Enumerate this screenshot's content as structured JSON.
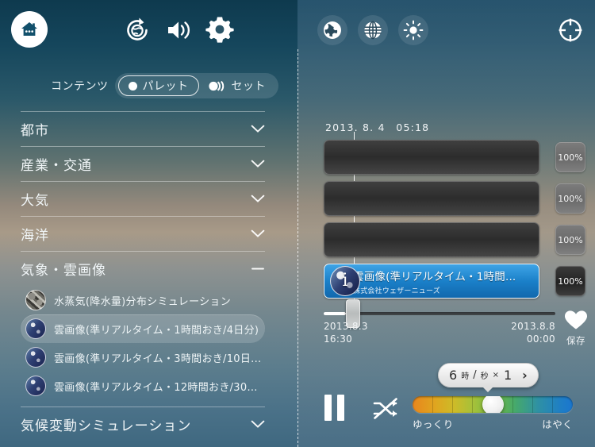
{
  "topbar": {
    "home_button": "home-icon",
    "buttons": [
      {
        "name": "globe-rotate-icon",
        "label": ""
      },
      {
        "name": "volume-icon",
        "label": ""
      },
      {
        "name": "gear-icon",
        "label": ""
      },
      {
        "name": "earth-icon",
        "label": ""
      },
      {
        "name": "grid-globe-icon",
        "label": ""
      },
      {
        "name": "brightness-icon",
        "label": ""
      },
      {
        "name": "crosshair-icon",
        "label": ""
      }
    ]
  },
  "content_toggle": {
    "label": "コンテンツ",
    "options": [
      {
        "label": "パレット",
        "selected": true
      },
      {
        "label": "セット",
        "selected": false
      }
    ]
  },
  "sidebar": {
    "categories": [
      {
        "label": "都市",
        "expanded": false,
        "toggle": "⌄"
      },
      {
        "label": "産業・交通",
        "expanded": false,
        "toggle": "⌄"
      },
      {
        "label": "大気",
        "expanded": false,
        "toggle": "⌄"
      },
      {
        "label": "海洋",
        "expanded": false,
        "toggle": "⌄"
      },
      {
        "label": "気象・雲画像",
        "expanded": true,
        "toggle": "−"
      }
    ],
    "items": [
      {
        "label": "水蒸気(降水量)分布シミュレーション",
        "selected": false,
        "thumb": "vapor"
      },
      {
        "label": "雲画像(準リアルタイム・1時間おき/4日分)",
        "selected": true,
        "thumb": "cloud"
      },
      {
        "label": "雲画像(準リアルタイム・3時間おき/10日...",
        "selected": false,
        "thumb": "cloud"
      },
      {
        "label": "雲画像(準リアルタイム・12時間おき/30...",
        "selected": false,
        "thumb": "cloud"
      }
    ],
    "last_category": {
      "label": "気候変動シミュレーション",
      "toggle": "⌄"
    }
  },
  "timeline": {
    "current_datetime": "2013. 8. 4　05:18",
    "layers": [
      {
        "title": "",
        "subtitle": "",
        "opacity": "100%",
        "active": false
      },
      {
        "title": "",
        "subtitle": "",
        "opacity": "100%",
        "active": false
      },
      {
        "title": "",
        "subtitle": "",
        "opacity": "100%",
        "active": false
      },
      {
        "title": "雲画像(準リアルタイム・1時間...",
        "subtitle": "株式会社ウェザーニューズ",
        "opacity": "100%",
        "active": true
      }
    ],
    "range_start_date": "2013.8.3",
    "range_start_time": "16:30",
    "range_end_date": "2013.8.8",
    "range_end_time": "00:00",
    "save": {
      "label": "保存",
      "icon": "heart-icon"
    }
  },
  "playback": {
    "pause_icon": "pause-icon",
    "shuffle_icon": "shuffle-off-icon",
    "speed": {
      "value": "6",
      "unit": "時",
      "separator": "/",
      "per": "秒",
      "multiplier_symbol": "×",
      "multiplier": "1",
      "arrow": "›"
    },
    "speed_slider": {
      "slow_label": "ゆっくり",
      "fast_label": "はやく",
      "position_percent": 50
    }
  },
  "colors": {
    "accent_blue": "#1a7fc8",
    "panel_dark": "#2c2c2c",
    "text_light": "#f1f6f8"
  }
}
